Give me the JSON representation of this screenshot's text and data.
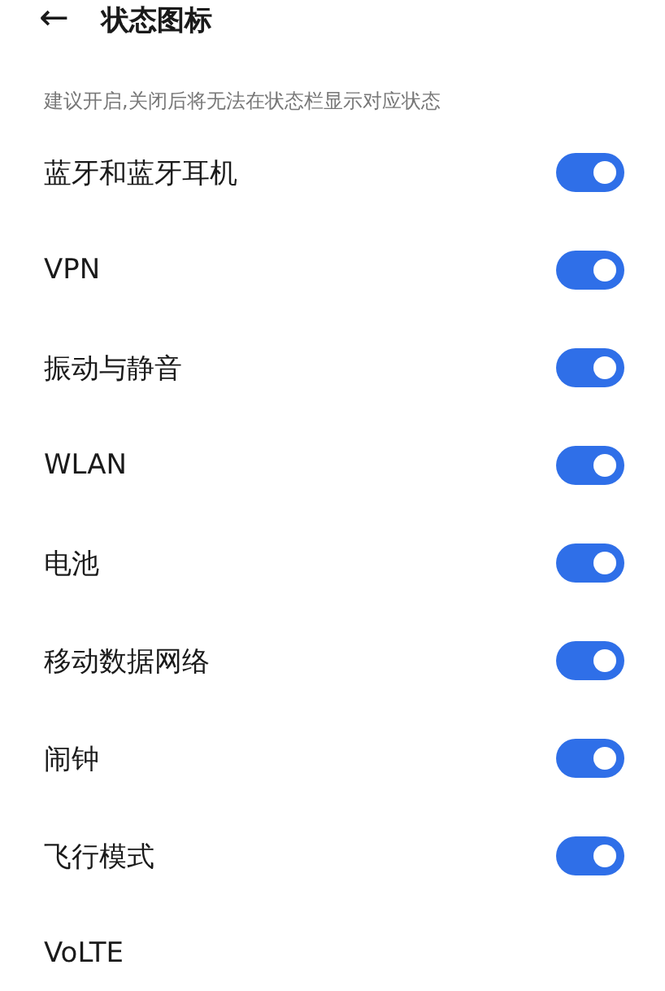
{
  "header": {
    "back": "←",
    "title": "状态图标"
  },
  "hint": "建议开启,关闭后将无法在状态栏显示对应状态",
  "items": [
    {
      "label": "蓝牙和蓝牙耳机",
      "kind": "switch",
      "on": true
    },
    {
      "label": "VPN",
      "kind": "switch",
      "on": true
    },
    {
      "label": "振动与静音",
      "kind": "switch",
      "on": true
    },
    {
      "label": "WLAN",
      "kind": "switch",
      "on": true
    },
    {
      "label": "电池",
      "kind": "switch",
      "on": true
    },
    {
      "label": "移动数据网络",
      "kind": "switch",
      "on": true
    },
    {
      "label": "闹钟",
      "kind": "switch",
      "on": true
    },
    {
      "label": "飞行模式",
      "kind": "switch",
      "on": true
    },
    {
      "label": "VoLTE",
      "kind": "label"
    }
  ]
}
